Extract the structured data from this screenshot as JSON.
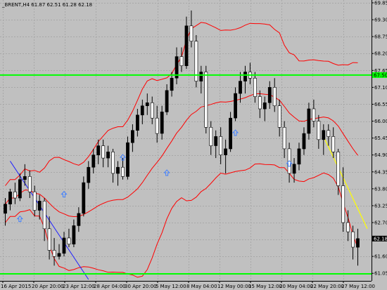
{
  "header": {
    "text": "_BRENT,H4  61.87 62.51 61.28 62.18"
  },
  "colors": {
    "background": "#c0c0c0",
    "grid": "#a8a8a8",
    "bull_candle": "#000000",
    "bear_candle": "#ffffff",
    "wick": "#000000",
    "bollinger": "#ff0000",
    "support_line": "#00ff00",
    "trend_line_blue": "#2020ff",
    "trend_line_yellow": "#ffff00",
    "arrow": "#4080ff"
  },
  "chart_data": {
    "type": "candlestick",
    "symbol": "_BRENT",
    "timeframe": "H4",
    "last_price": "62.18",
    "horizontal_line_price": "67.50",
    "ylim": [
      60.85,
      69.85
    ],
    "y_ticks": [
      "69.85",
      "69.30",
      "68.75",
      "68.20",
      "67.65",
      "67.10",
      "66.55",
      "66.00",
      "65.45",
      "64.90",
      "64.35",
      "63.80",
      "63.25",
      "62.70",
      "62.15",
      "61.60",
      "61.05"
    ],
    "x_ticks": [
      "16 Apr 2015",
      "20 Apr 20:00",
      "23 Apr 12:00",
      "28 Apr 04:00",
      "30 Apr 20:00",
      "5 May 12:00",
      "8 May 04:00",
      "12 May 00:00",
      "15 May 12:00",
      "20 May 04:00",
      "22 May 20:00",
      "27 May 12:00"
    ],
    "candles": [
      [
        63.0,
        63.5,
        62.6,
        63.3
      ],
      [
        63.3,
        63.8,
        63.1,
        63.7
      ],
      [
        63.7,
        64.0,
        63.3,
        63.5
      ],
      [
        63.5,
        64.3,
        63.4,
        64.1
      ],
      [
        64.1,
        64.6,
        63.9,
        64.2
      ],
      [
        64.2,
        64.4,
        63.5,
        63.7
      ],
      [
        63.7,
        63.9,
        62.9,
        63.1
      ],
      [
        63.1,
        63.6,
        62.8,
        63.4
      ],
      [
        63.4,
        63.5,
        62.1,
        62.5
      ],
      [
        62.5,
        62.9,
        61.5,
        61.8
      ],
      [
        61.8,
        62.2,
        61.3,
        61.6
      ],
      [
        61.6,
        62.0,
        61.5,
        61.7
      ],
      [
        61.7,
        62.4,
        61.6,
        62.2
      ],
      [
        62.2,
        62.5,
        61.9,
        62.0
      ],
      [
        62.0,
        62.8,
        61.9,
        62.6
      ],
      [
        62.6,
        63.2,
        62.4,
        63.0
      ],
      [
        63.0,
        64.2,
        62.9,
        64.0
      ],
      [
        64.0,
        64.7,
        63.8,
        64.5
      ],
      [
        64.5,
        65.1,
        64.3,
        64.9
      ],
      [
        64.9,
        65.4,
        64.6,
        65.2
      ],
      [
        65.2,
        65.4,
        64.5,
        64.8
      ],
      [
        64.8,
        65.2,
        64.5,
        65.0
      ],
      [
        65.0,
        65.1,
        64.0,
        64.3
      ],
      [
        64.3,
        64.7,
        63.9,
        64.5
      ],
      [
        64.5,
        64.8,
        64.1,
        64.2
      ],
      [
        64.2,
        65.5,
        64.1,
        65.3
      ],
      [
        65.3,
        65.9,
        65.0,
        65.7
      ],
      [
        65.7,
        66.4,
        65.5,
        66.2
      ],
      [
        66.2,
        66.7,
        65.9,
        66.5
      ],
      [
        66.5,
        66.9,
        66.2,
        66.6
      ],
      [
        66.6,
        66.8,
        65.9,
        66.1
      ],
      [
        66.1,
        66.5,
        65.3,
        65.6
      ],
      [
        65.6,
        66.5,
        65.4,
        66.3
      ],
      [
        66.3,
        67.2,
        66.2,
        67.0
      ],
      [
        67.0,
        67.6,
        66.8,
        67.4
      ],
      [
        67.4,
        68.4,
        67.2,
        68.1
      ],
      [
        68.1,
        68.4,
        67.6,
        67.8
      ],
      [
        67.8,
        69.4,
        67.7,
        69.1
      ],
      [
        69.1,
        69.6,
        68.4,
        68.6
      ],
      [
        68.6,
        68.8,
        67.1,
        67.3
      ],
      [
        67.3,
        67.8,
        66.9,
        67.6
      ],
      [
        67.6,
        67.8,
        65.6,
        65.8
      ],
      [
        65.8,
        66.0,
        64.9,
        65.2
      ],
      [
        65.2,
        65.7,
        64.8,
        65.5
      ],
      [
        65.5,
        65.8,
        64.6,
        64.9
      ],
      [
        64.9,
        65.4,
        64.3,
        65.1
      ],
      [
        65.1,
        66.3,
        65.0,
        66.1
      ],
      [
        66.1,
        67.1,
        66.0,
        66.9
      ],
      [
        66.9,
        67.6,
        66.6,
        67.3
      ],
      [
        67.3,
        67.8,
        66.9,
        67.6
      ],
      [
        67.6,
        67.9,
        67.2,
        67.4
      ],
      [
        67.4,
        67.6,
        66.6,
        66.8
      ],
      [
        66.8,
        67.0,
        66.1,
        66.4
      ],
      [
        66.4,
        66.8,
        66.0,
        66.6
      ],
      [
        66.6,
        67.3,
        66.4,
        67.1
      ],
      [
        67.1,
        67.4,
        66.3,
        66.5
      ],
      [
        66.5,
        66.7,
        65.5,
        65.8
      ],
      [
        65.8,
        66.0,
        64.8,
        65.1
      ],
      [
        65.1,
        65.3,
        64.0,
        64.3
      ],
      [
        64.3,
        64.8,
        64.0,
        64.6
      ],
      [
        64.6,
        65.3,
        64.4,
        65.1
      ],
      [
        65.1,
        65.8,
        64.9,
        65.6
      ],
      [
        65.6,
        66.6,
        65.4,
        66.4
      ],
      [
        66.4,
        66.7,
        65.8,
        66.0
      ],
      [
        66.0,
        66.2,
        65.1,
        65.4
      ],
      [
        65.4,
        65.9,
        64.9,
        65.7
      ],
      [
        65.7,
        65.9,
        65.2,
        65.5
      ],
      [
        65.5,
        65.8,
        64.8,
        65.0
      ],
      [
        65.0,
        65.1,
        63.6,
        63.9
      ],
      [
        63.9,
        64.5,
        62.4,
        62.7
      ],
      [
        62.7,
        63.1,
        62.1,
        62.4
      ],
      [
        62.4,
        62.6,
        61.5,
        61.9
      ],
      [
        61.9,
        62.5,
        61.3,
        62.18
      ]
    ],
    "indicators": [
      "Bollinger Bands",
      "Horizontal level line",
      "Trend lines",
      "Arrow signals"
    ]
  }
}
